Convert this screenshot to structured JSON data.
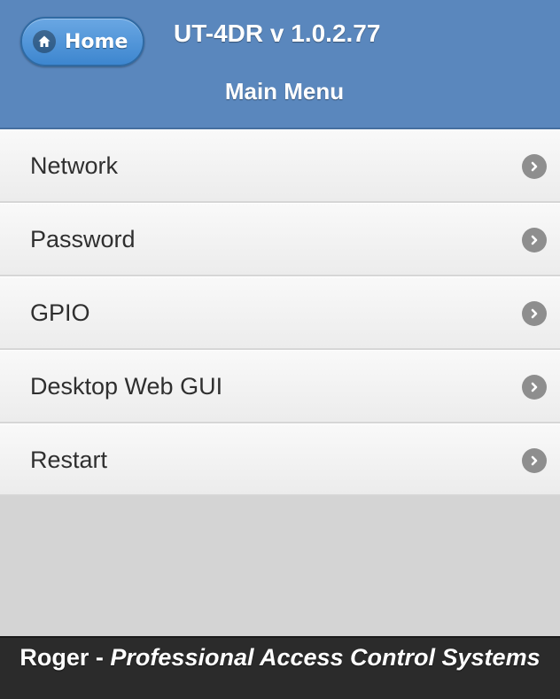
{
  "header": {
    "home_button": {
      "label": "Home",
      "icon": "home-icon"
    },
    "title": "UT-4DR v 1.0.2.77",
    "subtitle": "Main Menu",
    "bar_color": "#5a87bd",
    "button_color": "#3d86cf"
  },
  "menu": {
    "items": [
      {
        "label": "Network",
        "icon": "chevron-right-icon"
      },
      {
        "label": "Password",
        "icon": "chevron-right-icon"
      },
      {
        "label": "GPIO",
        "icon": "chevron-right-icon"
      },
      {
        "label": "Desktop Web GUI",
        "icon": "chevron-right-icon"
      },
      {
        "label": "Restart",
        "icon": "chevron-right-icon"
      }
    ]
  },
  "footer": {
    "brand": "Roger - ",
    "tagline": "Professional Access Control Systems",
    "background_color": "#2b2b2b"
  }
}
